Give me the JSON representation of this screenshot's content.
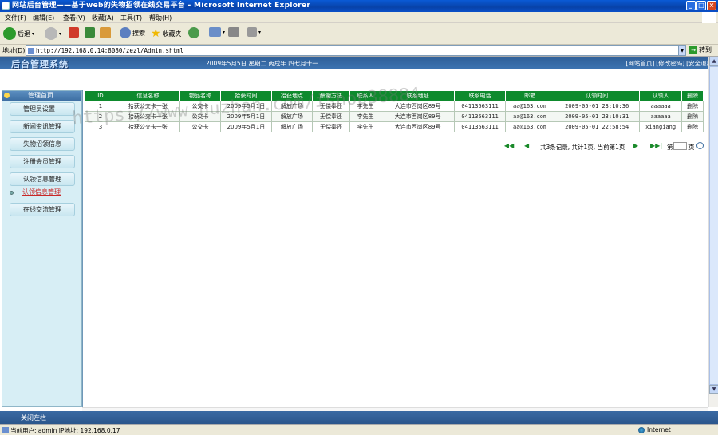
{
  "window": {
    "title": "网站后台管理——基于web的失物招领在线交易平台 - Microsoft Internet Explorer"
  },
  "menu": [
    "文件(F)",
    "编辑(E)",
    "查看(V)",
    "收藏(A)",
    "工具(T)",
    "帮助(H)"
  ],
  "toolbar": {
    "back_label": "后退",
    "search_label": "搜索",
    "favorites_label": "收藏夹"
  },
  "address": {
    "label": "地址(D)",
    "url": "http://192.168.0.14:8080/zezl/Admin.shtml",
    "go_label": "转到"
  },
  "header": {
    "logo": "后台管理系统",
    "date_text": "2009年5月5日 星期二 丙戌年 四七月十一",
    "links": [
      "[网站首页]",
      "[修改密码]",
      "[安全退出]"
    ]
  },
  "sidebar": {
    "head": "管理首页",
    "items": [
      {
        "label": "管理员设置"
      },
      {
        "label": "新闻资讯管理"
      },
      {
        "label": "失物招领信息"
      },
      {
        "label": "注册会员管理"
      },
      {
        "label": "认领信息管理"
      },
      {
        "label": "认领信息管理"
      },
      {
        "label": "在线交流管理"
      }
    ]
  },
  "table": {
    "headers": [
      "ID",
      "信息名称",
      "物品名称",
      "拾获时间",
      "拾获地点",
      "酬谢方法",
      "联系人",
      "联系地址",
      "联系电话",
      "邮箱",
      "认领时间",
      "认领人",
      "删除"
    ],
    "rows": [
      [
        "1",
        "拾获公交卡一张",
        "公交卡",
        "2009年5月1日",
        "解放广场",
        "无偿奉还",
        "李先生",
        "大连市西岗区89号",
        "04113563111",
        "aa@163.com",
        "2009-05-01 23:10:36",
        "aaaaaa",
        "删除"
      ],
      [
        "2",
        "拾获公交卡一张",
        "公交卡",
        "2009年5月1日",
        "解放广场",
        "无偿奉还",
        "李先生",
        "大连市西岗区89号",
        "04113563111",
        "aa@163.com",
        "2009-05-01 23:10:31",
        "aaaaaa",
        "删除"
      ],
      [
        "3",
        "拾获公交卡一张",
        "公交卡",
        "2009年5月1日",
        "解放广场",
        "无偿奉还",
        "李先生",
        "大连市西岗区89号",
        "04113563111",
        "aa@163.com",
        "2009-05-01 22:58:54",
        "xiangiang",
        "删除"
      ]
    ]
  },
  "pager": {
    "info": "共3条记录, 共计1页, 当前第1页",
    "jump_label": "第",
    "unit_label": "页"
  },
  "footer": {
    "label": "关闭左栏"
  },
  "status": {
    "text": "当前用户: admin  IP地址: 192.168.0.17",
    "zone": "Internet"
  },
  "watermark": "https://www.huzhan.com/ishop38884"
}
